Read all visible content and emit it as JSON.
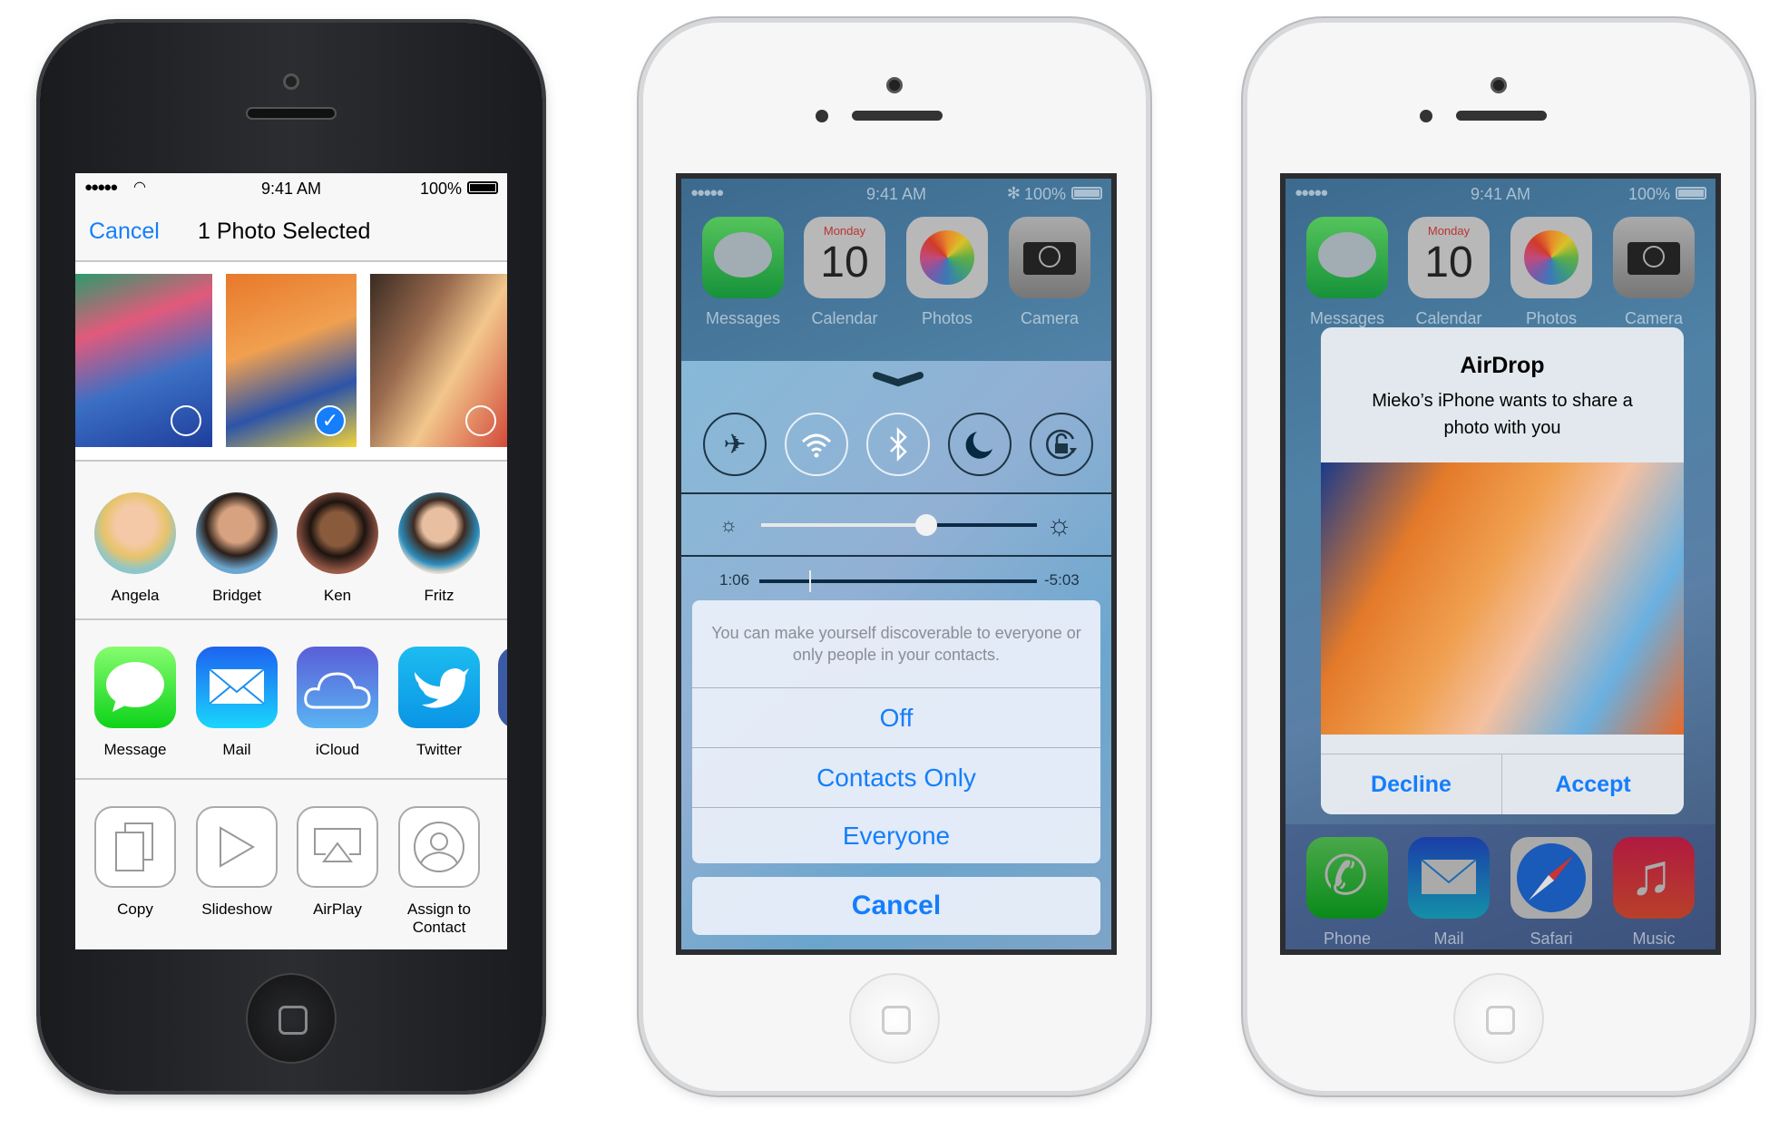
{
  "phone_share": {
    "status": {
      "signal": "●●●●●",
      "time": "9:41 AM",
      "battery": "100%"
    },
    "nav": {
      "cancel": "Cancel",
      "title": "1 Photo Selected"
    },
    "photos": [
      {
        "selected": false
      },
      {
        "selected": true
      },
      {
        "selected": false
      }
    ],
    "checkmark": "✓",
    "contacts": [
      {
        "name": "Angela"
      },
      {
        "name": "Bridget"
      },
      {
        "name": "Ken"
      },
      {
        "name": "Fritz"
      }
    ],
    "share_apps": [
      {
        "label": "Message",
        "icon": "message-icon"
      },
      {
        "label": "Mail",
        "icon": "mail-icon"
      },
      {
        "label": "iCloud",
        "icon": "icloud-icon"
      },
      {
        "label": "Twitter",
        "icon": "twitter-icon"
      }
    ],
    "actions": [
      {
        "label": "Copy",
        "icon": "copy-icon"
      },
      {
        "label": "Slideshow",
        "icon": "play-icon"
      },
      {
        "label": "AirPlay",
        "icon": "airplay-icon"
      },
      {
        "label": "Assign to Contact",
        "icon": "contact-icon"
      }
    ]
  },
  "phone_control_center": {
    "status": {
      "signal": "●●●●●",
      "time": "9:41 AM",
      "battery": "100%"
    },
    "apps": [
      {
        "label": "Messages"
      },
      {
        "label": "Calendar",
        "day": "Monday",
        "date": "10"
      },
      {
        "label": "Photos"
      },
      {
        "label": "Camera"
      }
    ],
    "toggles": [
      {
        "name": "airplane-mode",
        "on": true
      },
      {
        "name": "wifi",
        "on": false
      },
      {
        "name": "bluetooth",
        "on": false
      },
      {
        "name": "do-not-disturb",
        "on": true
      },
      {
        "name": "rotation-lock",
        "on": true
      }
    ],
    "brightness": 0.6,
    "music": {
      "elapsed": "1:06",
      "remaining": "-5:03",
      "progress": 0.18
    },
    "airdrop_sheet": {
      "message": "You can make yourself discoverable to everyone or only people in your contacts.",
      "options": [
        "Off",
        "Contacts Only",
        "Everyone"
      ],
      "cancel": "Cancel"
    }
  },
  "phone_airdrop": {
    "status": {
      "signal": "●●●●●",
      "time": "9:41 AM",
      "battery": "100%"
    },
    "apps": [
      {
        "label": "Messages"
      },
      {
        "label": "Calendar",
        "day": "Monday",
        "date": "10"
      },
      {
        "label": "Photos"
      },
      {
        "label": "Camera"
      }
    ],
    "dock": [
      {
        "label": "Phone"
      },
      {
        "label": "Mail"
      },
      {
        "label": "Safari"
      },
      {
        "label": "Music"
      }
    ],
    "alert": {
      "title": "AirDrop",
      "message": "Mieko’s iPhone wants to share a photo with you",
      "decline": "Decline",
      "accept": "Accept"
    }
  },
  "colors": {
    "accent": "#157efb",
    "share_bg": "#f7f7f7"
  }
}
